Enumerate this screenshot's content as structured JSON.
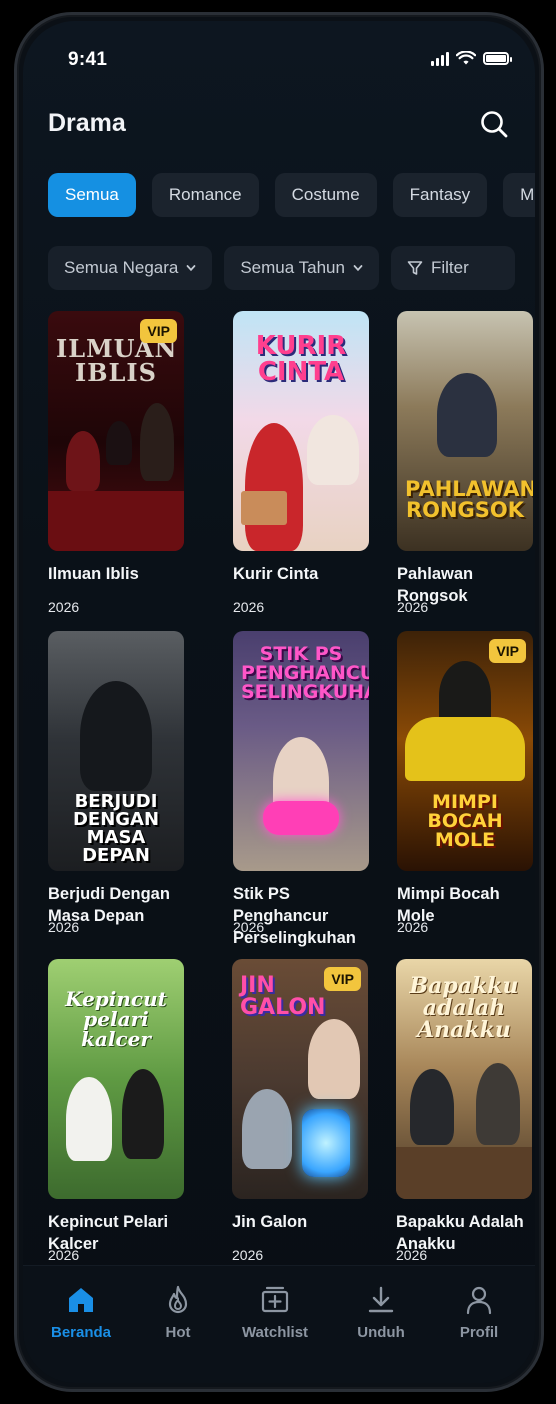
{
  "status": {
    "time": "9:41"
  },
  "header": {
    "title": "Drama"
  },
  "genres": [
    "Semua",
    "Romance",
    "Costume",
    "Fantasy",
    "Mo"
  ],
  "filters": {
    "country": "Semua Negara",
    "year": "Semua Tahun",
    "filter": "Filter"
  },
  "dramas": [
    {
      "title": "Ilmuan Iblis",
      "year": "2026",
      "vip": "VIP",
      "poster_text": "ILMUAN IBLIS"
    },
    {
      "title": "Kurir Cinta",
      "year": "2026",
      "vip": "",
      "poster_text": "KURIR CINTA"
    },
    {
      "title": "Pahlawan Rongsok",
      "year": "2026",
      "vip": "",
      "poster_text": "PAHLAWAN RONGSOK"
    },
    {
      "title": "Berjudi Dengan Masa Depan",
      "year": "2026",
      "vip": "",
      "poster_text": "BERJUDI DENGAN MASA DEPAN"
    },
    {
      "title": "Stik PS Penghancur Perselingkuhan",
      "year": "2026",
      "vip": "",
      "poster_text": "STIK PS PENGHANCUR SELINGKUHAN"
    },
    {
      "title": "Mimpi Bocah Mole",
      "year": "2026",
      "vip": "VIP",
      "poster_text": "MIMPI BOCAH MOLE"
    },
    {
      "title": "Kepincut Pelari Kalcer",
      "year": "2026",
      "vip": "",
      "poster_text": "Kepincut pelari kalcer"
    },
    {
      "title": "Jin Galon",
      "year": "2026",
      "vip": "VIP",
      "poster_text": "JIN GALON"
    },
    {
      "title": "Bapakku Adalah Anakku",
      "year": "2026",
      "vip": "",
      "poster_text": "Bapakku adalah Anakku"
    }
  ],
  "nav": [
    {
      "label": "Beranda",
      "icon": "home-icon",
      "active": true
    },
    {
      "label": "Hot",
      "icon": "flame-icon",
      "active": false
    },
    {
      "label": "Watchlist",
      "icon": "watchlist-icon",
      "active": false
    },
    {
      "label": "Unduh",
      "icon": "download-icon",
      "active": false
    },
    {
      "label": "Profil",
      "icon": "user-icon",
      "active": false
    }
  ],
  "colors": {
    "accent": "#1590E2",
    "vip": "#F2C53D",
    "background": "#0A1118"
  }
}
